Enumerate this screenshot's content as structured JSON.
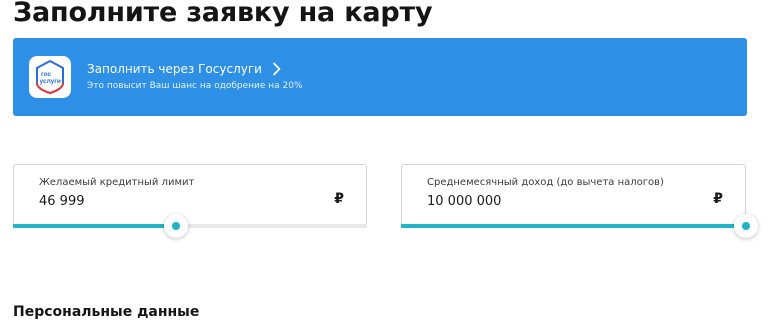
{
  "page": {
    "title": "Заполните заявку на карту"
  },
  "banner": {
    "logo_line1": "гос",
    "logo_line2": "услуги",
    "title": "Заполнить через Госуслуги",
    "subtitle": "Это повысит Ваш шанс на одобрение на 20%",
    "icon": "chevron-right-icon",
    "colors": {
      "background": "#2d8fe6",
      "logo_blue": "#2a6fd6",
      "logo_red": "#e5373d"
    }
  },
  "fields": {
    "credit_limit": {
      "label": "Желаемый кредитный лимит",
      "value": "46 999",
      "currency": "₽",
      "slider_fraction": 0.46
    },
    "income": {
      "label": "Среднемесячный доход (до вычета налогов)",
      "value": "10 000 000",
      "currency": "₽",
      "slider_fraction": 1.0
    }
  },
  "sections": {
    "personal": "Персональные данные"
  },
  "colors": {
    "slider_accent": "#22b5c7"
  }
}
